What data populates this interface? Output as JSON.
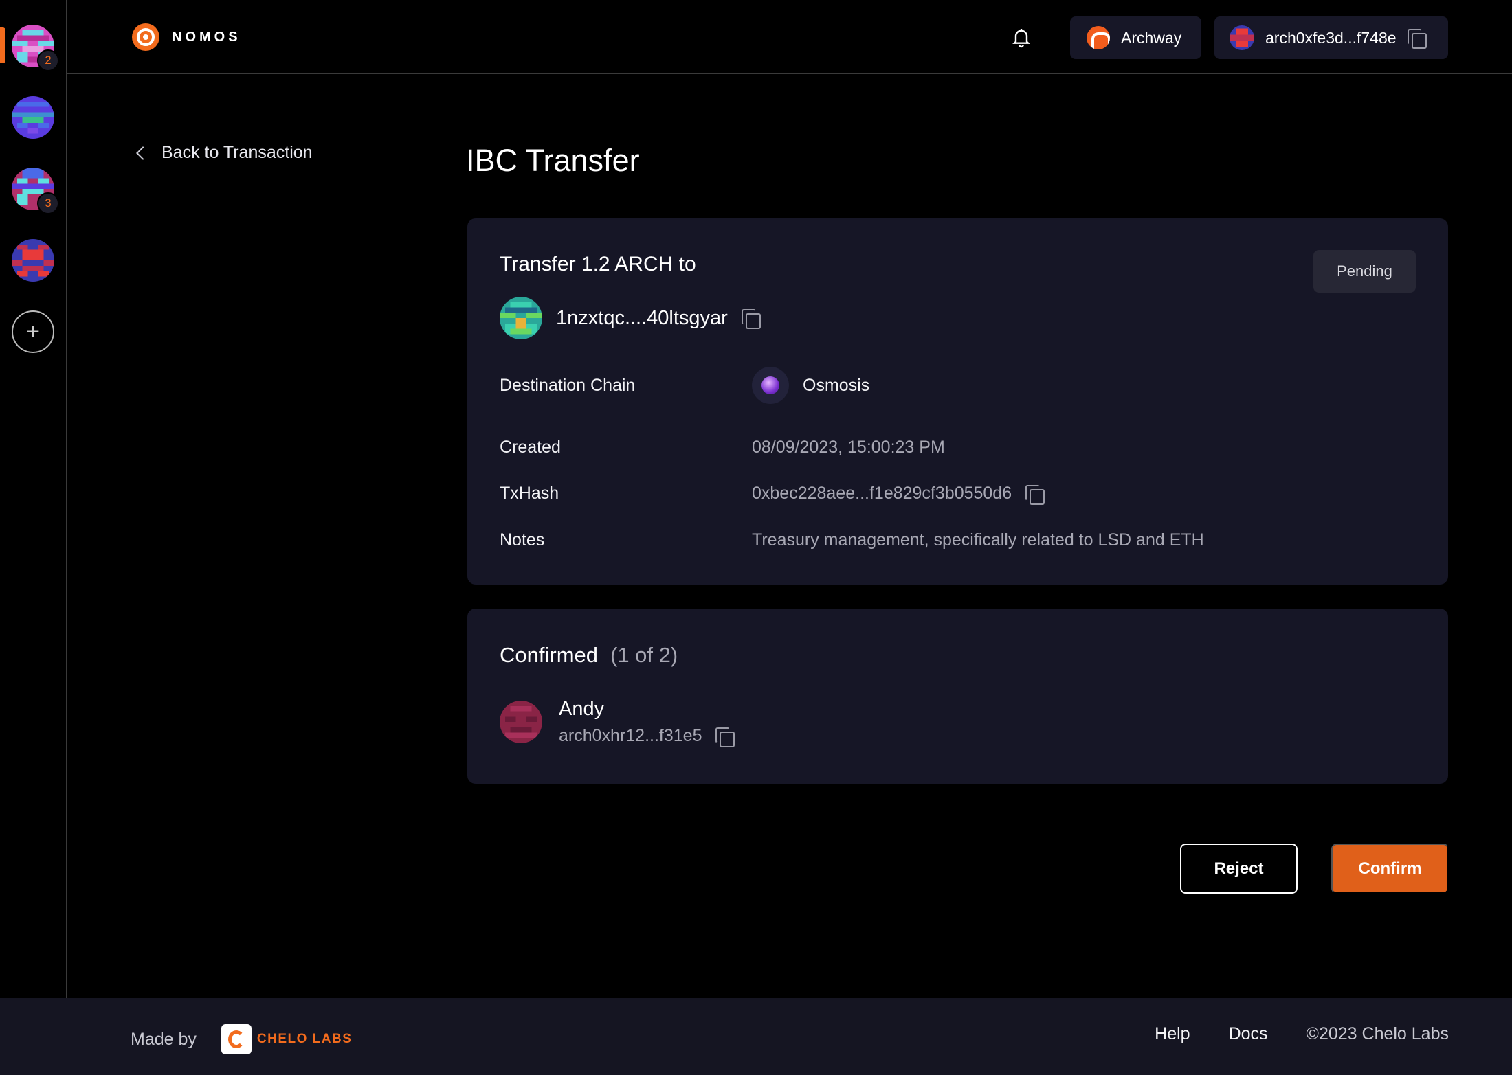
{
  "sidebar": {
    "items": [
      {
        "name": "safe-1",
        "badge": "2"
      },
      {
        "name": "safe-2",
        "badge": ""
      },
      {
        "name": "safe-3",
        "badge": "3"
      },
      {
        "name": "safe-4",
        "badge": ""
      }
    ],
    "add_label": "+"
  },
  "header": {
    "logo_text": "NOMOS",
    "chain_name": "Archway",
    "wallet_address": "arch0xfe3d...f748e"
  },
  "nav": {
    "back_label": "Back to Transaction"
  },
  "page": {
    "title": "IBC Transfer"
  },
  "transaction": {
    "title": "Transfer 1.2 ARCH to",
    "status": "Pending",
    "recipient": "1nzxtqc....40ltsgyar",
    "details": {
      "destination_label": "Destination Chain",
      "destination_value": "Osmosis",
      "created_label": "Created",
      "created_value": "08/09/2023, 15:00:23 PM",
      "txhash_label": "TxHash",
      "txhash_value": "0xbec228aee...f1e829cf3b0550d6",
      "notes_label": "Notes",
      "notes_value": "Treasury management, specifically related to LSD and ETH"
    }
  },
  "confirmations": {
    "title": "Confirmed",
    "count": "(1 of 2)",
    "signers": [
      {
        "name": "Andy",
        "address": "arch0xhr12...f31e5"
      }
    ]
  },
  "actions": {
    "reject_label": "Reject",
    "confirm_label": "Confirm"
  },
  "footer": {
    "made_by": "Made by",
    "brand": "CHELO LABS",
    "help": "Help",
    "docs": "Docs",
    "copyright": "©2023 Chelo Labs"
  },
  "colors": {
    "accent": "#f26b1d",
    "card_bg": "#161626",
    "page_bg": "#000000"
  }
}
